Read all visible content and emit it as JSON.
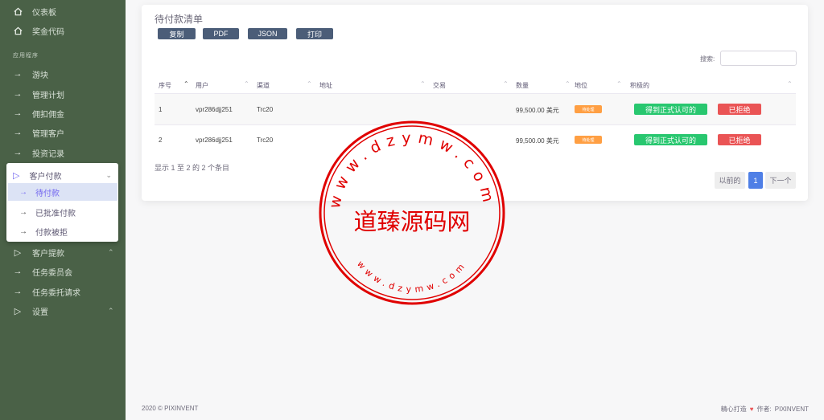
{
  "sidebar": {
    "top_items": [
      {
        "label": "仪表板",
        "icon": "home-icon"
      },
      {
        "label": "奖金代码",
        "icon": "home-icon"
      }
    ],
    "section_label": "应用程序",
    "items": [
      {
        "label": "游块",
        "icon": "arrow-right-icon"
      },
      {
        "label": "管理计划",
        "icon": "arrow-right-icon"
      },
      {
        "label": "佣扣佣金",
        "icon": "arrow-right-icon"
      },
      {
        "label": "管理客户",
        "icon": "arrow-right-icon"
      },
      {
        "label": "投资记录",
        "icon": "arrow-right-icon"
      }
    ],
    "customer_payment": {
      "label": "客户付款",
      "sub_items": [
        {
          "label": "待付款",
          "active": true
        },
        {
          "label": "已批准付款",
          "active": false
        },
        {
          "label": "付款被拒",
          "active": false
        }
      ]
    },
    "bottom_items": [
      {
        "label": "客户提款",
        "icon": "triangle-right-icon",
        "chevron": true
      },
      {
        "label": "任务委员会",
        "icon": "arrow-right-icon",
        "chevron": false
      },
      {
        "label": "任务委托请求",
        "icon": "arrow-right-icon",
        "chevron": false
      },
      {
        "label": "设置",
        "icon": "triangle-right-icon",
        "chevron": true
      }
    ]
  },
  "card": {
    "title": "待付款清单",
    "buttons": [
      "复制",
      "PDF",
      "JSON",
      "打印"
    ],
    "search_label": "搜索:",
    "search_value": ""
  },
  "table": {
    "columns": [
      "序号",
      "用户",
      "渠道",
      "地址",
      "交易",
      "数量",
      "地位",
      "积极的"
    ],
    "rows": [
      {
        "no": "1",
        "user": "vpr286djj251",
        "channel": "Trc20",
        "address": "",
        "transaction": "",
        "amount": "99,500.00 美元",
        "status": "待处理",
        "approve": "得到正式认可的",
        "reject": "已拒绝"
      },
      {
        "no": "2",
        "user": "vpr286djj251",
        "channel": "Trc20",
        "address": "",
        "transaction": "",
        "amount": "99,500.00 美元",
        "status": "待处理",
        "approve": "得到正式认可的",
        "reject": "已拒绝"
      }
    ],
    "info": "显示 1 至 2 的 2 个条目"
  },
  "pagination": {
    "prev": "以前的",
    "current": "1",
    "next": "下一个"
  },
  "footer": {
    "left": "2020 © PIXINVENT",
    "right_prefix": "精心打造",
    "right_author_label": "作者:",
    "right_author": "PIXINVENT"
  },
  "watermark": {
    "center": "道臻源码网",
    "top_ring": "www.dzymw.com",
    "bottom_ring": "www.dzymw.com",
    "color": "#e00000"
  },
  "colors": {
    "sidebar": "#4a6147",
    "primary": "#4f7fe6",
    "success": "#28c76f",
    "danger": "#ea5455",
    "warning": "#ff9f43",
    "button": "#4b5d78"
  }
}
